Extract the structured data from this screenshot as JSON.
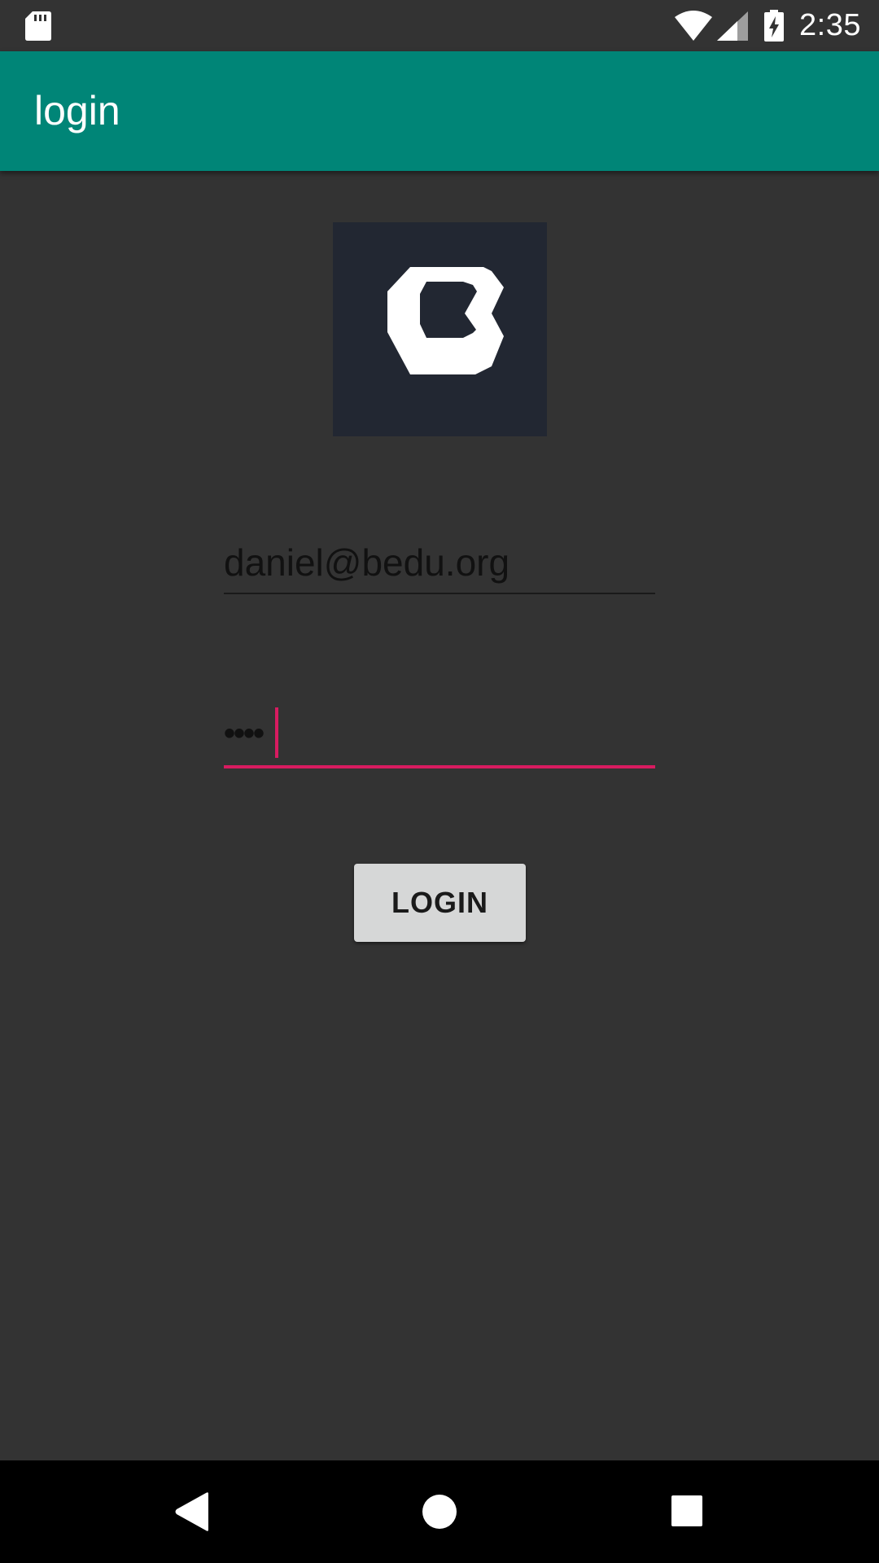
{
  "status_bar": {
    "time": "2:35",
    "icons": [
      "sd-card-icon",
      "wifi-icon",
      "signal-icon",
      "battery-charging-icon"
    ]
  },
  "app_bar": {
    "title": "login",
    "color": "#008577"
  },
  "logo": {
    "icon": "bedu-logo-icon",
    "background": "#222732"
  },
  "form": {
    "email": {
      "value": "daniel@bedu.org",
      "placeholder": ""
    },
    "password": {
      "value": "••••",
      "focused": true,
      "accent": "#d81b60"
    },
    "login_button": {
      "label": "LOGIN"
    }
  },
  "nav_bar": {
    "icons": [
      "back-icon",
      "home-icon",
      "recents-icon"
    ]
  }
}
